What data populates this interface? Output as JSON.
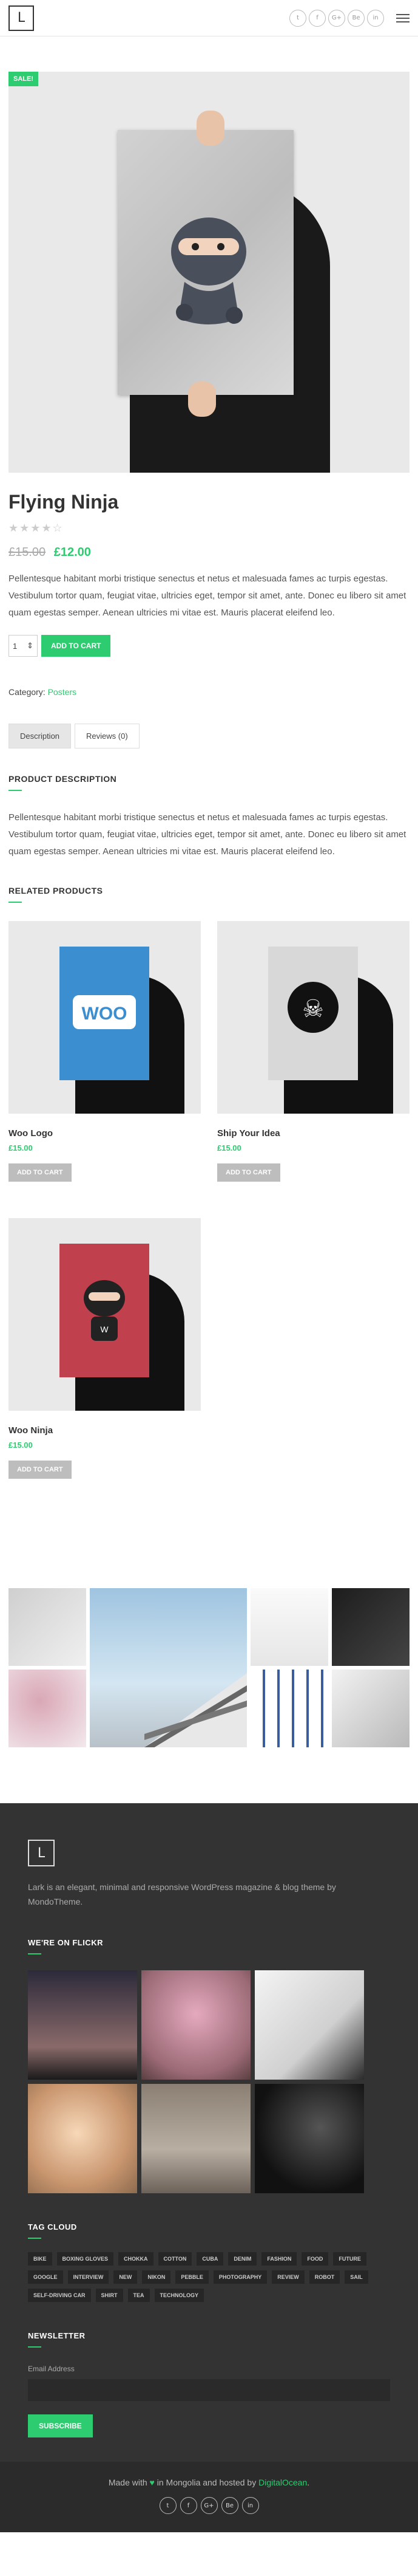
{
  "header": {
    "logo": "L",
    "social": [
      "t",
      "f",
      "G+",
      "Be",
      "in"
    ]
  },
  "product": {
    "sale_badge": "SALE!",
    "title": "Flying Ninja",
    "stars": "★★★★☆",
    "old_price": "£15.00",
    "new_price": "£12.00",
    "description": "Pellentesque habitant morbi tristique senectus et netus et malesuada fames ac turpis egestas. Vestibulum tortor quam, feugiat vitae, ultricies eget, tempor sit amet, ante. Donec eu libero sit amet quam egestas semper. Aenean ultricies mi vitae est. Mauris placerat eleifend leo.",
    "qty": "1",
    "add_to_cart": "ADD TO CART",
    "category_label": "Category:",
    "category": "Posters"
  },
  "tabs": [
    "Description",
    "Reviews (0)"
  ],
  "description_section": {
    "heading": "PRODUCT DESCRIPTION",
    "text": "Pellentesque habitant morbi tristique senectus et netus et malesuada fames ac turpis egestas. Vestibulum tortor quam, feugiat vitae, ultricies eget, tempor sit amet, ante. Donec eu libero sit amet quam egestas semper. Aenean ultricies mi vitae est. Mauris placerat eleifend leo."
  },
  "related": {
    "heading": "RELATED PRODUCTS",
    "button": "ADD TO CART",
    "items": [
      {
        "name": "Woo Logo",
        "price": "£15.00",
        "art": "WOO",
        "color": "#3b8fd0"
      },
      {
        "name": "Ship Your Idea",
        "price": "£15.00",
        "art": "☠",
        "color": "#d8d8d8"
      },
      {
        "name": "Woo Ninja",
        "price": "£15.00",
        "art": "W",
        "color": "#c0404e"
      }
    ]
  },
  "footer": {
    "logo": "L",
    "about": "Lark is an elegant, minimal and responsive WordPress magazine & blog theme by MondoTheme.",
    "flickr_heading": "WE'RE ON FLICKR",
    "tag_heading": "TAG CLOUD",
    "tags": [
      "BIKE",
      "BOXING GLOVES",
      "CHOKKA",
      "COTTON",
      "CUBA",
      "DENIM",
      "FASHION",
      "FOOD",
      "FUTURE",
      "GOOGLE",
      "INTERVIEW",
      "NEW",
      "NIKON",
      "PEBBLE",
      "PHOTOGRAPHY",
      "REVIEW",
      "ROBOT",
      "SAIL",
      "SELF-DRIVING CAR",
      "SHIRT",
      "TEA",
      "TECHNOLOGY"
    ],
    "newsletter_heading": "NEWSLETTER",
    "email_label": "Email Address",
    "subscribe": "SUBSCRIBE",
    "made_with": "Made with",
    "in_text": "in Mongolia and hosted by",
    "host": "DigitalOcean",
    "social": [
      "t",
      "f",
      "G+",
      "Be",
      "in"
    ]
  }
}
